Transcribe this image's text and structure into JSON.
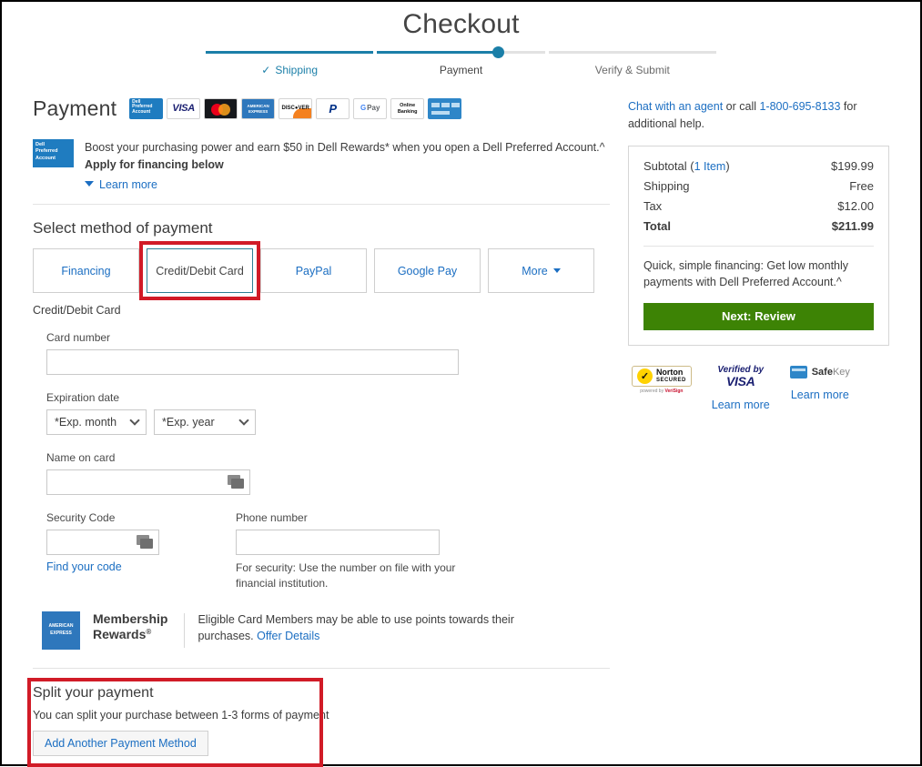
{
  "page": {
    "title": "Checkout",
    "accent_teal": "#1b7fa8",
    "link_blue": "#1b6ec2",
    "annotation_red": "#d11b27",
    "cta_green": "#3d8305"
  },
  "progress": {
    "steps": [
      {
        "label": "Shipping",
        "state": "done",
        "check": "✓"
      },
      {
        "label": "Payment",
        "state": "active"
      },
      {
        "label": "Verify & Submit",
        "state": "upcoming"
      }
    ]
  },
  "payment": {
    "heading": "Payment",
    "accepted_logos": [
      {
        "name": "dell-preferred-account",
        "text": "Dell Preferred Account"
      },
      {
        "name": "visa",
        "text": "VISA"
      },
      {
        "name": "mastercard",
        "text": "MasterCard"
      },
      {
        "name": "american-express",
        "text": "AMERICAN EXPRESS"
      },
      {
        "name": "discover",
        "text": "DISC VER"
      },
      {
        "name": "paypal",
        "text": "PayPal"
      },
      {
        "name": "google-pay",
        "text": "Pay"
      },
      {
        "name": "online-banking",
        "text": "Online Banking"
      },
      {
        "name": "gift-card",
        "text": "Gift Card"
      }
    ],
    "financing_banner": {
      "badge_text": "Dell Preferred Account",
      "message": "Boost your purchasing power and earn $50 in Dell Rewards* when you open a Dell Preferred Account.^",
      "bold_line": "Apply for financing below",
      "learn_more": "Learn more"
    },
    "select_method_title": "Select method of payment",
    "tabs": [
      {
        "label": "Financing",
        "selected": false
      },
      {
        "label": "Credit/Debit Card",
        "selected": true
      },
      {
        "label": "PayPal",
        "selected": false
      },
      {
        "label": "Google Pay",
        "selected": false
      },
      {
        "label": "More",
        "selected": false,
        "has_caret": true
      }
    ],
    "selected_method_label": "Credit/Debit Card",
    "form": {
      "card_number_label": "Card number",
      "card_number_value": "",
      "expiration_label": "Expiration date",
      "exp_month_value": "*Exp. month",
      "exp_year_value": "*Exp. year",
      "name_on_card_label": "Name on card",
      "name_on_card_value": "",
      "security_code_label": "Security Code",
      "security_code_value": "",
      "find_your_code": "Find your code",
      "phone_label": "Phone number",
      "phone_value": "",
      "phone_helper": "For security: Use the number on file with your financial institution."
    },
    "membership_rewards": {
      "logo_text": "AMERICAN EXPRESS",
      "title_line1": "Membership",
      "title_line2": "Rewards",
      "note": "Eligible Card Members may be able to use points towards their purchases.",
      "offer_link": "Offer Details"
    },
    "split": {
      "title": "Split your payment",
      "description": "You can split your purchase between 1-3 forms of payment",
      "button": "Add Another Payment Method"
    }
  },
  "sidebar": {
    "help": {
      "chat_link": "Chat with an agent",
      "mid": " or call ",
      "phone": "1-800-695-8133",
      "tail": " for additional help."
    },
    "summary": {
      "rows": [
        {
          "label": "Subtotal (",
          "link": "1 Item",
          "label_end": ")",
          "value": "$199.99"
        },
        {
          "label": "Shipping",
          "value": "Free"
        },
        {
          "label": "Tax",
          "value": "$12.00"
        }
      ],
      "total_label": "Total",
      "total_value": "$211.99",
      "financing_note": "Quick, simple financing: Get low monthly payments with Dell Preferred Account.^",
      "next_button": "Next: Review"
    },
    "badges": [
      {
        "name": "norton-secured",
        "title": "Norton",
        "sub": "SECURED",
        "footer": "powered by VeriSign",
        "learn_more": ""
      },
      {
        "name": "verified-by-visa",
        "line1": "Verified",
        "line2": "by",
        "brand": "VISA",
        "learn_more": "Learn more"
      },
      {
        "name": "amex-safekey",
        "brand_bold": "Safe",
        "brand_light": "Key",
        "learn_more": "Learn more"
      }
    ]
  }
}
